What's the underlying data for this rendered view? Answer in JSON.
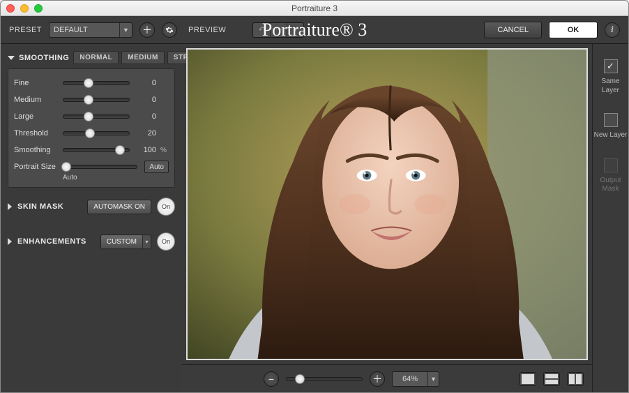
{
  "window": {
    "title": "Portraiture 3"
  },
  "brand": {
    "name": "Portraiture® 3"
  },
  "toolbar": {
    "preset_label": "PRESET",
    "preset_value": "DEFAULT",
    "preview_label": "PREVIEW",
    "cancel": "CANCEL",
    "ok": "OK"
  },
  "smoothing": {
    "heading": "SMOOTHING",
    "modes": [
      "NORMAL",
      "MEDIUM",
      "STRONG"
    ],
    "sliders": {
      "fine": {
        "label": "Fine",
        "value": "0",
        "pos": 0.38
      },
      "medium": {
        "label": "Medium",
        "value": "0",
        "pos": 0.38
      },
      "large": {
        "label": "Large",
        "value": "0",
        "pos": 0.38
      },
      "threshold": {
        "label": "Threshold",
        "value": "20",
        "pos": 0.4
      },
      "smooth": {
        "label": "Smoothing",
        "value": "100",
        "unit": "%",
        "pos": 0.86
      },
      "psize": {
        "label": "Portrait Size",
        "value": "Auto",
        "pos": 0.02,
        "auto_button": "Auto",
        "hint": "Auto"
      }
    }
  },
  "skinmask": {
    "heading": "SKIN MASK",
    "automask": "AUTOMASK ON",
    "on": "On"
  },
  "enhancements": {
    "heading": "ENHANCEMENTS",
    "mode": "CUSTOM",
    "on": "On"
  },
  "zoom": {
    "value": "64%",
    "pos": 0.18
  },
  "right": {
    "same_layer_checked": true,
    "same_layer": "Same Layer",
    "new_layer": "New Layer",
    "output_mask": "Output Mask"
  }
}
